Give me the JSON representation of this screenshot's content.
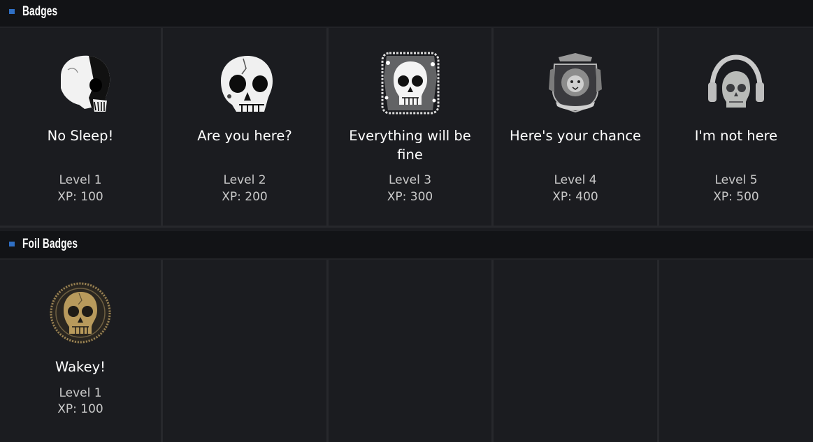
{
  "sections": [
    {
      "title": "Badges",
      "badges": [
        {
          "name": "No Sleep!",
          "level": "Level 1",
          "xp": "XP: 100",
          "icon": "skull-side-icon"
        },
        {
          "name": "Are you here?",
          "level": "Level 2",
          "xp": "XP: 200",
          "icon": "cracked-skull-icon"
        },
        {
          "name": "Everything will be fine",
          "level": "Level 3",
          "xp": "XP: 300",
          "icon": "grunge-skull-icon"
        },
        {
          "name": "Here's your chance",
          "level": "Level 4",
          "xp": "XP: 400",
          "icon": "lion-crest-icon"
        },
        {
          "name": "I'm not here",
          "level": "Level 5",
          "xp": "XP: 500",
          "icon": "headphone-skull-icon"
        }
      ]
    },
    {
      "title": "Foil Badges",
      "badges": [
        {
          "name": "Wakey!",
          "level": "Level 1",
          "xp": "XP: 100",
          "icon": "gold-skull-seal-icon"
        }
      ]
    }
  ],
  "colors": {
    "background": "#1b1c20",
    "header_bg": "#121316",
    "accent": "#2f6fc4",
    "foil_gold": "#b89a5c"
  }
}
